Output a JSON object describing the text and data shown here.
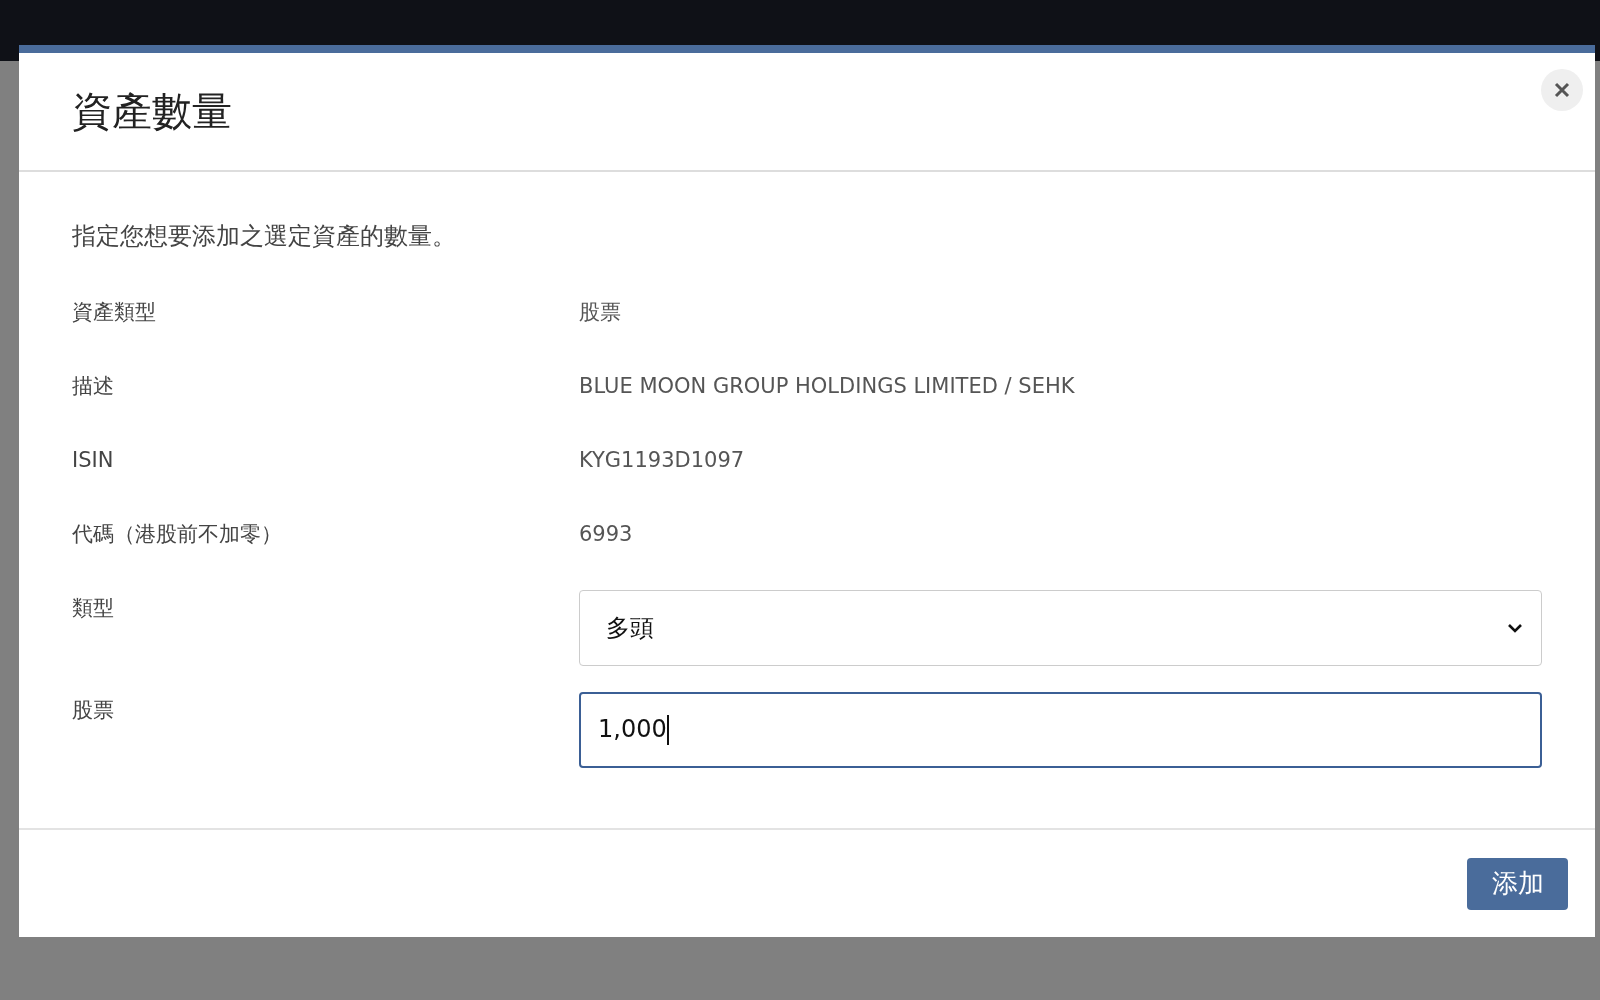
{
  "dialog": {
    "title": "資產數量",
    "description": "指定您想要添加之選定資產的數量。",
    "fields": [
      {
        "kind": "text",
        "label": "資產類型",
        "value": "股票"
      },
      {
        "kind": "text",
        "label": "描述",
        "value": "BLUE MOON GROUP HOLDINGS LIMITED / SEHK"
      },
      {
        "kind": "text",
        "label": "ISIN",
        "value": "KYG1193D1097"
      },
      {
        "kind": "text",
        "label": "代碼（港股前不加零）",
        "value": "6993"
      },
      {
        "kind": "select",
        "label": "類型",
        "value": "多頭"
      },
      {
        "kind": "input",
        "label": "股票",
        "value": "1,000",
        "focused": true
      }
    ],
    "buttons": [
      {
        "label": "添加"
      }
    ]
  }
}
